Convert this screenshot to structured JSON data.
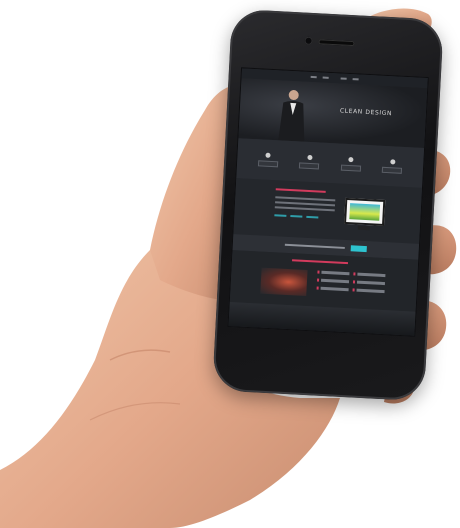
{
  "image": {
    "subject": "hand-holding-smartphone",
    "background_color": "#ffffff"
  },
  "phone": {
    "color": "#111113",
    "screen": {
      "site": {
        "logo": "",
        "hero_title": "CLEAN DESIGN",
        "accent_color": "#d23b5d",
        "secondary_accent": "#2ec3cf",
        "footer_text": ""
      }
    }
  }
}
